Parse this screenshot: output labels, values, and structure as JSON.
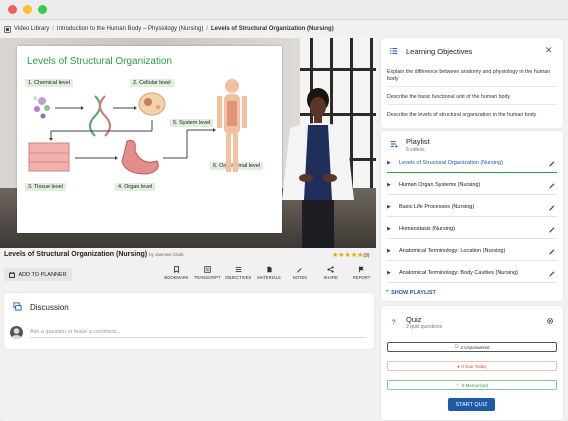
{
  "breadcrumb": [
    "Video Library",
    "Introduction to the Human Body – Physiology (Nursing)",
    "Levels of Structural Organization (Nursing)"
  ],
  "video": {
    "slide_title": "Levels of Structural Organization",
    "levels": [
      "1. Chemical level",
      "2. Cellular level",
      "3. Tissue level",
      "4. Organ level",
      "5. System level",
      "6. Organismal level"
    ]
  },
  "video_info": {
    "title": "Levels of Structural Organization (Nursing)",
    "by": "by Jasmine Clark",
    "stars": "★★★★★",
    "rating_count": "(9)"
  },
  "add_planner": "ADD TO PLANNER",
  "actions": [
    "BOOKMARK",
    "TRANSCRIPT",
    "OBJECTIVES",
    "MATERIALS",
    "NOTES",
    "SHARE",
    "REPORT"
  ],
  "discussion": {
    "title": "Discussion",
    "placeholder": "Ask a question or leave a comment..."
  },
  "objectives": {
    "title": "Learning Objectives",
    "items": [
      "Explain the difference between anatomy and physiology in the human body",
      "Describe the basic functional unit of the human body",
      "Describe the levels of structural organization in the human body"
    ]
  },
  "playlist": {
    "title": "Playlist",
    "subtitle": "8 videos",
    "items": [
      "Levels of Structural Organization (Nursing)",
      "Human Organ Systems (Nursing)",
      "Basic Life Processes (Nursing)",
      "Homeostasis (Nursing)",
      "Anatomical Terminology: Location (Nursing)",
      "Anatomical Terminology: Body Cavities (Nursing)"
    ],
    "show": "SHOW PLAYLIST"
  },
  "quiz": {
    "title": "Quiz",
    "subtitle": "2 quiz questions",
    "unanswered": "2 Unanswered",
    "due": "0 Due Today",
    "memorized": "0 Memorized",
    "start": "START QUIZ"
  },
  "colors": {
    "accent": "#1f5aa8",
    "green": "#2e9a52",
    "due": "#d04a2a"
  }
}
